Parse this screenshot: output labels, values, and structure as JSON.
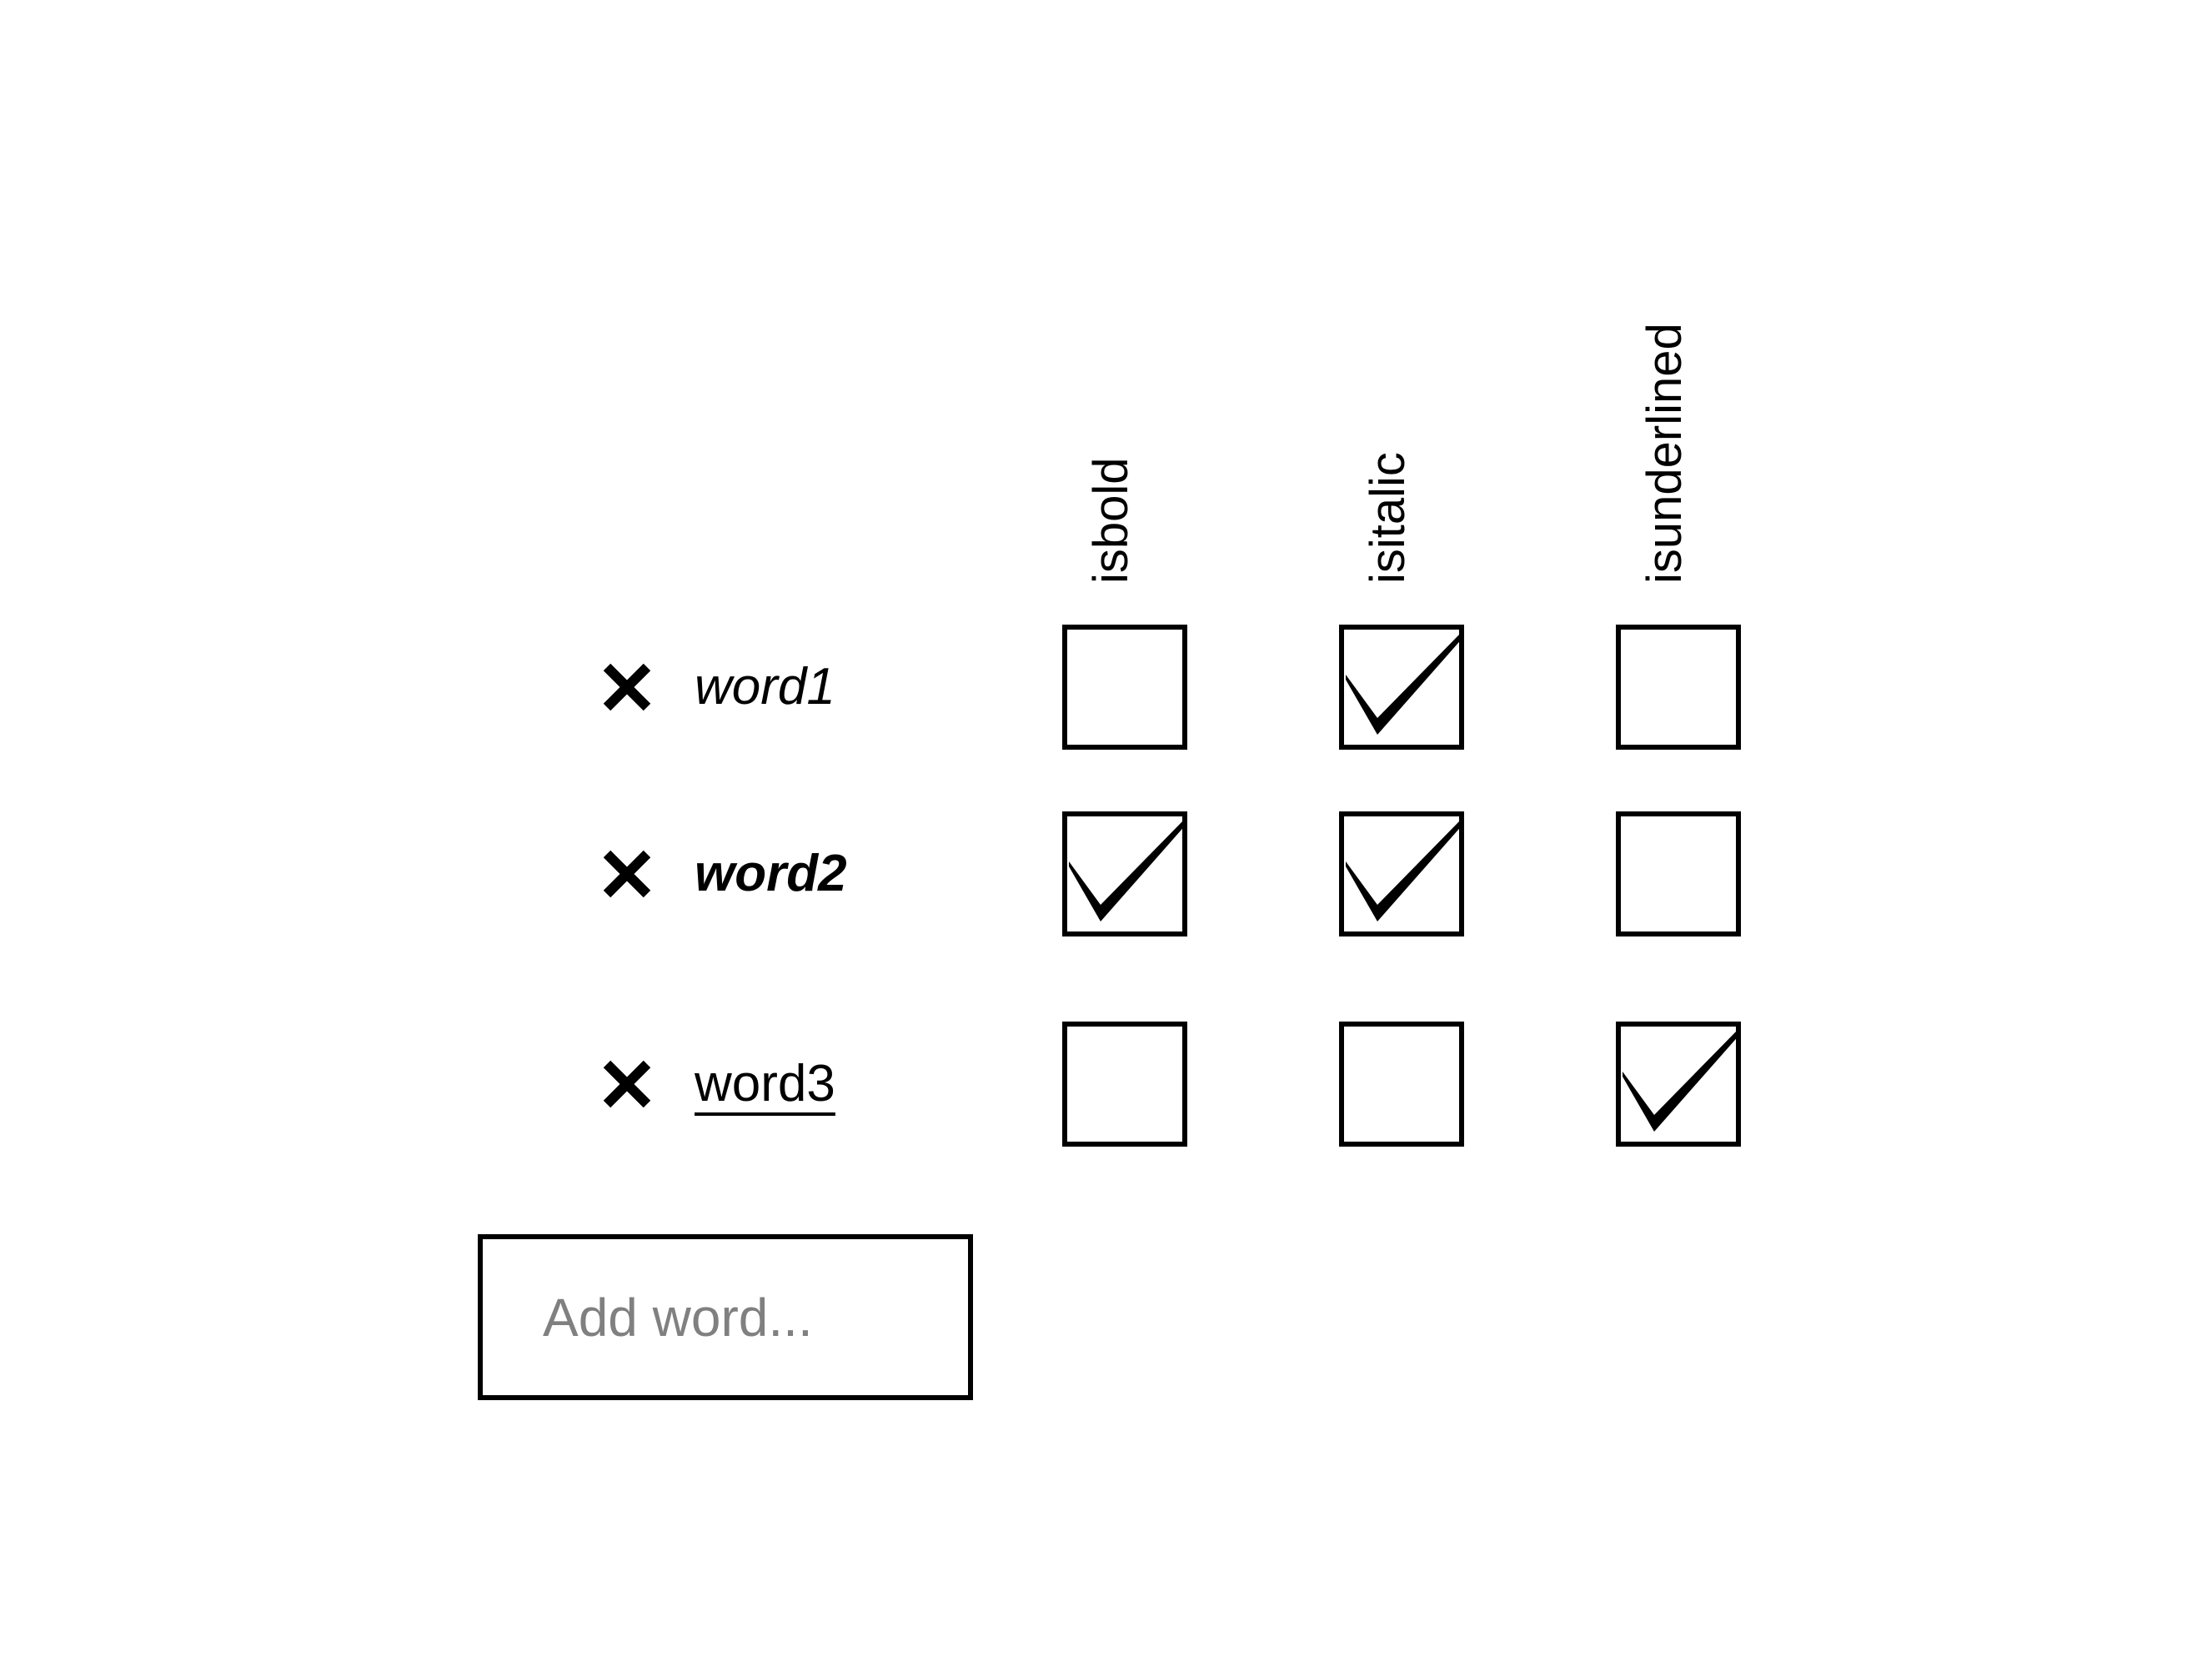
{
  "columns": [
    {
      "key": "bold",
      "label": "isbold"
    },
    {
      "key": "italic",
      "label": "isitalic"
    },
    {
      "key": "underlined",
      "label": "isunderlined"
    }
  ],
  "words": [
    {
      "text": "word1",
      "bold": false,
      "italic": true,
      "underlined": false
    },
    {
      "text": "word2",
      "bold": true,
      "italic": true,
      "underlined": false
    },
    {
      "text": "word3",
      "bold": false,
      "italic": false,
      "underlined": true
    }
  ],
  "add_word": {
    "placeholder": "Add word...",
    "value": ""
  },
  "icons": {
    "delete": "close-icon",
    "check": "checkmark-icon"
  }
}
